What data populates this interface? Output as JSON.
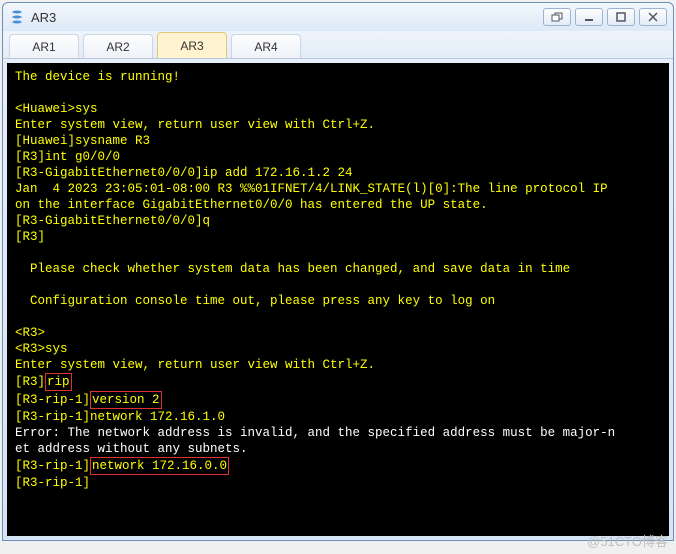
{
  "window": {
    "title": "AR3"
  },
  "tabs": [
    {
      "label": "AR1"
    },
    {
      "label": "AR2"
    },
    {
      "label": "AR3"
    },
    {
      "label": "AR4"
    }
  ],
  "term": {
    "l1": "The device is running!",
    "l2": "<Huawei>sys",
    "l3": "Enter system view, return user view with Ctrl+Z.",
    "l4": "[Huawei]sysname R3",
    "l5": "[R3]int g0/0/0",
    "l6": "[R3-GigabitEthernet0/0/0]ip add 172.16.1.2 24",
    "l7": "Jan  4 2023 23:05:01-08:00 R3 %%01IFNET/4/LINK_STATE(l)[0]:The line protocol IP",
    "l8": "on the interface GigabitEthernet0/0/0 has entered the UP state.",
    "l9": "[R3-GigabitEthernet0/0/0]q",
    "l10": "[R3]",
    "l11": "  Please check whether system data has been changed, and save data in time",
    "l12": "  Configuration console time out, please press any key to log on",
    "l13": "<R3>",
    "l14": "<R3>sys",
    "l15": "Enter system view, return user view with Ctrl+Z.",
    "l16a": "[R3]",
    "l16b": "rip",
    "l17a": "[R3-rip-1]",
    "l17b": "version 2",
    "l18": "[R3-rip-1]network 172.16.1.0",
    "l19": "Error: The network address is invalid, and the specified address must be major-n",
    "l20": "et address without any subnets.",
    "l21a": "[R3-rip-1]",
    "l21b": "network 172.16.0.0",
    "l22": "[R3-rip-1]"
  },
  "watermark": "@51CTO博客"
}
